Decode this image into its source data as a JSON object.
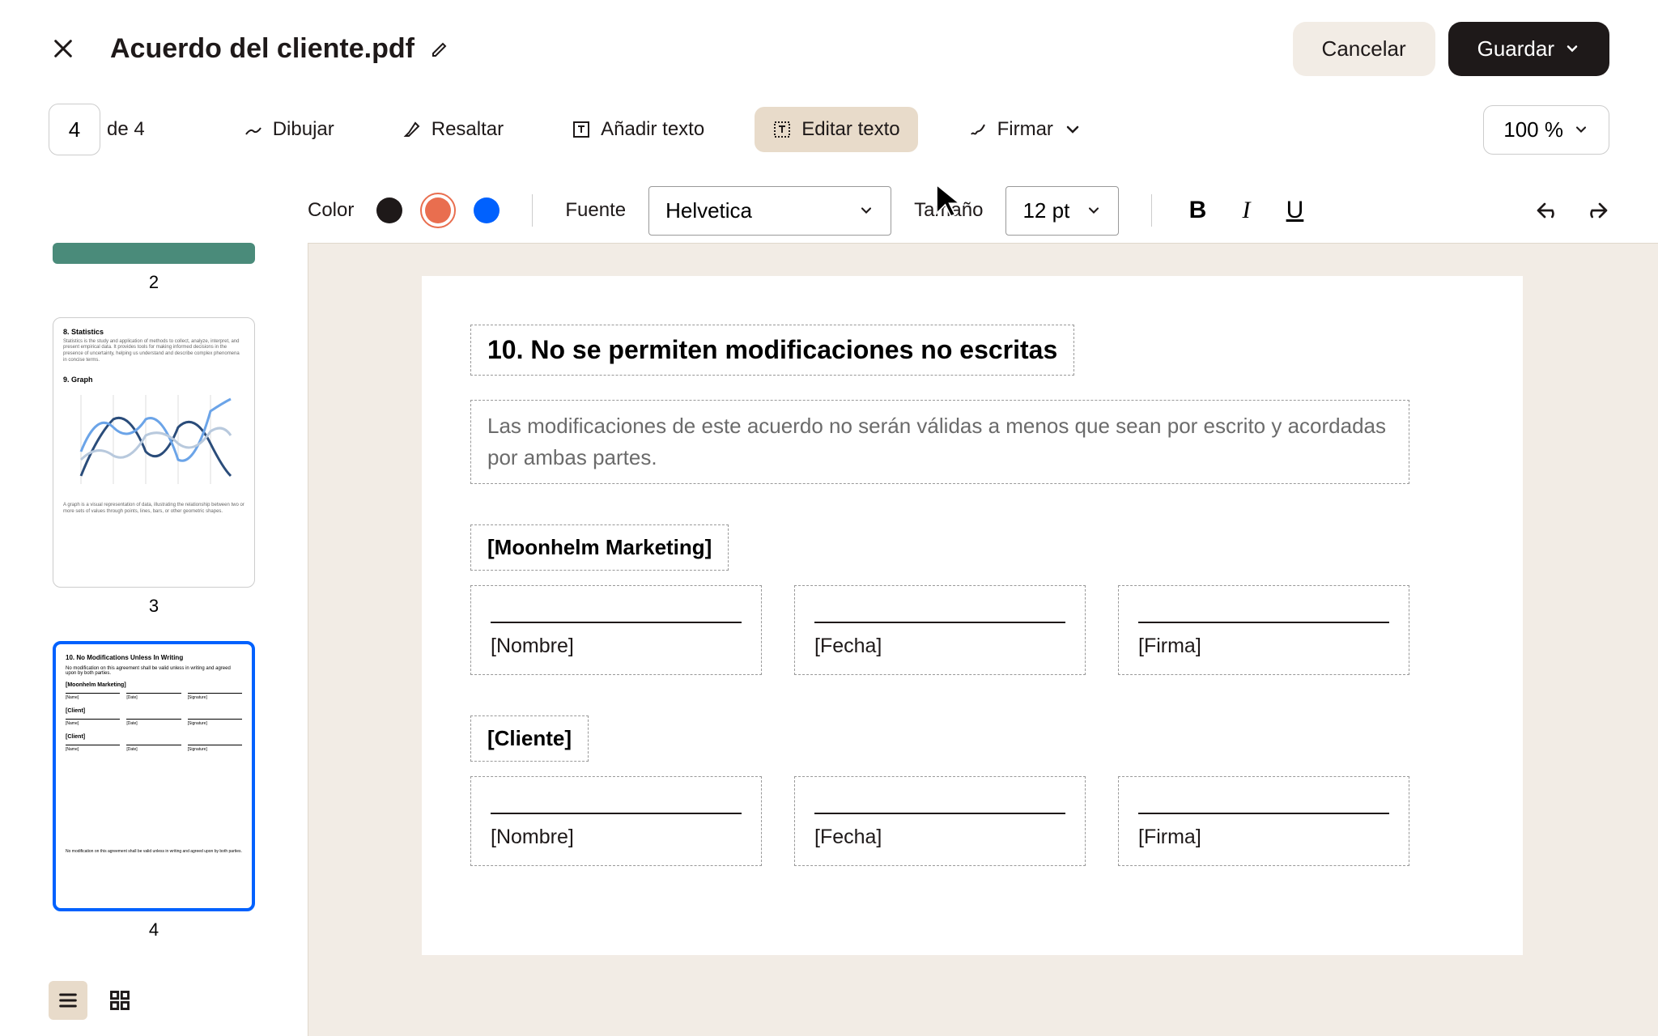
{
  "header": {
    "filename": "Acuerdo del cliente.pdf",
    "cancel_label": "Cancelar",
    "save_label": "Guardar"
  },
  "toolbar": {
    "page_current": "4",
    "page_total": "de 4",
    "draw": "Dibujar",
    "highlight": "Resaltar",
    "add_text": "Añadir texto",
    "edit_text": "Editar texto",
    "sign": "Firmar",
    "zoom": "100 %"
  },
  "format": {
    "color_label": "Color",
    "font_label": "Fuente",
    "font_value": "Helvetica",
    "size_label": "Tamaño",
    "size_value": "12 pt",
    "colors": {
      "black": "#1e1919",
      "orange": "#e96e4f",
      "blue": "#0061fe"
    }
  },
  "sidebar": {
    "thumb2_label": "2",
    "thumb3_label": "3",
    "thumb4_label": "4",
    "thumb3": {
      "stat_title": "8. Statistics",
      "stat_text": "Statistics is the study and application of methods to collect, analyze, interpret, and present empirical data. It provides tools for making informed decisions in the presence of uncertainty, helping us understand and describe complex phenomena in concise terms.",
      "graph_title": "9. Graph",
      "graph_text": "A graph is a visual representation of data, illustrating the relationship between two or more sets of values through points, lines, bars, or other geometric shapes."
    },
    "thumb4": {
      "title": "10. No Modifications Unless In Writing",
      "text": "No modification on this agreement shall be valid unless in writing and agreed upon by both parties.",
      "party1": "[Moonhelm Marketing]",
      "party2": "[Client]",
      "name": "[Name]",
      "date": "[Date]",
      "signature": "[Signature]",
      "footer": "No modification on this agreement shall be valid unless in writing and agreed upon by both parties."
    }
  },
  "page": {
    "section_title": "10. No se permiten modificaciones no escritas",
    "section_body": "Las modificaciones de este acuerdo no serán válidas a menos que sean por escrito y acordadas por ambas partes.",
    "party1": "[Moonhelm Marketing]",
    "party2": "[Cliente]",
    "field_name": "[Nombre]",
    "field_date": "[Fecha]",
    "field_signature": "[Firma]"
  }
}
